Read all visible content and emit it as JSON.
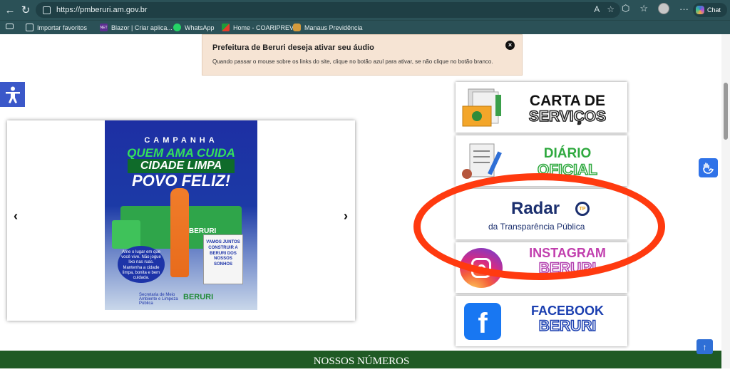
{
  "browser": {
    "url": "https://pmberuri.am.gov.br",
    "chat_label": "Chat",
    "bookmarks": [
      {
        "label": "Importar favoritos",
        "icon": "folder-icon"
      },
      {
        "label": "Blazor | Criar aplica...",
        "icon": "net-icon"
      },
      {
        "label": "WhatsApp",
        "icon": "whatsapp-icon"
      },
      {
        "label": "Home - COARIPREV",
        "icon": "coariprev-icon"
      },
      {
        "label": "Manaus Previdência",
        "icon": "manaus-icon"
      }
    ],
    "net_badge": "NET"
  },
  "notice": {
    "title": "Prefeitura de Beruri deseja ativar seu áudio",
    "text": "Quando passar o mouse sobre os links do site, clique no botão azul para ativar, se não clique no botão branco.",
    "close": "×"
  },
  "carousel": {
    "prev": "‹",
    "next": "›",
    "banner": {
      "campanha": "CAMPANHA",
      "line1": "QUEM AMA CUIDA",
      "line2": "CIDADE LIMPA",
      "line3": "POVO FELIZ!",
      "truck_label": "BERURI",
      "bubble_left": "Ame o lugar em que você vive. Não jogue lixo nas ruas. Mantenha a cidade limpa, bonita e bem cuidada.",
      "bubble_right": "VAMOS JUNTOS CONSTRUIR A BERURI DOS NOSSOS SONHOS",
      "foot": "Secretaria de Meio Ambiente e Limpeza Pública",
      "brand": "BERURI"
    }
  },
  "tiles": [
    {
      "l1": "CARTA DE",
      "l2": "SERVIÇOS",
      "icon": "documents-folder-icon"
    },
    {
      "l1": "DIÁRIO",
      "l2": "OFICIAL",
      "icon": "diary-document-icon"
    },
    {
      "l1": "Radar",
      "l2": "da Transparência Pública",
      "badge": "TP",
      "icon": "radar-transparency-icon"
    },
    {
      "l1": "INSTAGRAM",
      "l2": "BERURI",
      "icon": "instagram-icon"
    },
    {
      "l1": "FACEBOOK",
      "l2": "BERURI",
      "icon": "facebook-icon"
    }
  ],
  "footer": {
    "section_title": "NOSSOS NÚMEROS"
  },
  "colors": {
    "chrome": "#2b5157",
    "footer_green": "#1f5a24",
    "highlight_oval": "#ff3a0f",
    "accessibility_blue": "#3b58c9"
  }
}
